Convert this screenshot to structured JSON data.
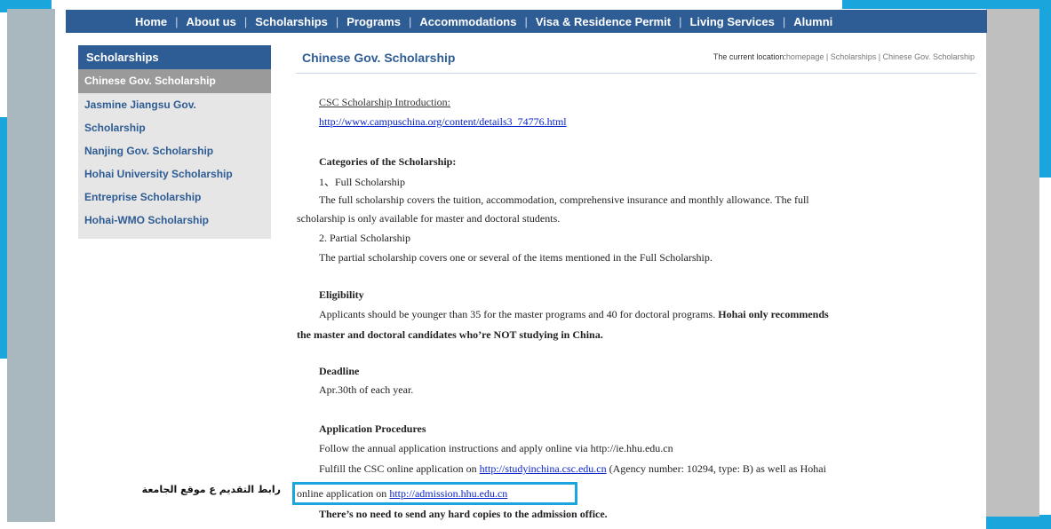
{
  "nav": {
    "items": [
      "Home",
      "About us",
      "Scholarships",
      "Programs",
      "Accommodations",
      "Visa & Residence Permit",
      "Living Services",
      "Alumni"
    ]
  },
  "sidebar": {
    "header": "Scholarships",
    "items": [
      {
        "label": "Chinese Gov. Scholarship"
      },
      {
        "label": "Jasmine Jiangsu Gov. Scholarship"
      },
      {
        "label": "Nanjing Gov. Scholarship"
      },
      {
        "label": "Hohai University Scholarship"
      },
      {
        "label": "Entreprise Scholarship"
      },
      {
        "label": "Hohai-WMO Scholarship"
      }
    ]
  },
  "content": {
    "title": "Chinese Gov. Scholarship",
    "breadcrumb_prefix": "The current location:",
    "breadcrumb_path": "homepage | Scholarships | Chinese Gov. Scholarship",
    "intro_heading": "CSC Scholarship Introduction:",
    "intro_link": "http://www.campuschina.org/content/details3_74776.html",
    "categories_heading": "Categories of the Scholarship:",
    "full_title": "1、Full Scholarship",
    "full_desc_1": "The full scholarship covers the tuition, accommodation, comprehensive insurance and monthly allowance. The full",
    "full_desc_2": "scholarship is only available for master and doctoral students.",
    "partial_title": "2. Partial Scholarship",
    "partial_desc": "The partial scholarship covers one or several of the items mentioned in the Full Scholarship.",
    "eligibility_heading": "Eligibility",
    "eligibility_text": "Applicants should be younger than 35 for the master programs and 40 for doctoral programs.",
    "eligibility_bold_1": "Hohai only recommends",
    "eligibility_bold_2": "the master and doctoral candidates who’re NOT studying in China.",
    "deadline_heading": "Deadline",
    "deadline_text": "Apr.30th of each year.",
    "procedures_heading": "Application Procedures",
    "procedures_line1": "Follow the annual application instructions and apply online via http://ie.hhu.edu.cn",
    "procedures_line2_pre": "Fulfill the CSC online application on",
    "procedures_line2_link": "http://studyinchina.csc.edu.cn",
    "procedures_line2_post": "(Agency number: 10294, type: B) as well as Hohai",
    "procedures_line3_pre": "online application on",
    "procedures_line3_link": "http://admission.hhu.edu.cn",
    "no_copies": "There’s no need to send any hard copies to the admission office."
  },
  "annotation": {
    "arabic_note": "رابط التقديم ع موقع الجامعة"
  },
  "colors": {
    "nav_bg": "#2e5c94",
    "accent_cyan": "#1aa6dc",
    "link": "#0b24c8"
  }
}
